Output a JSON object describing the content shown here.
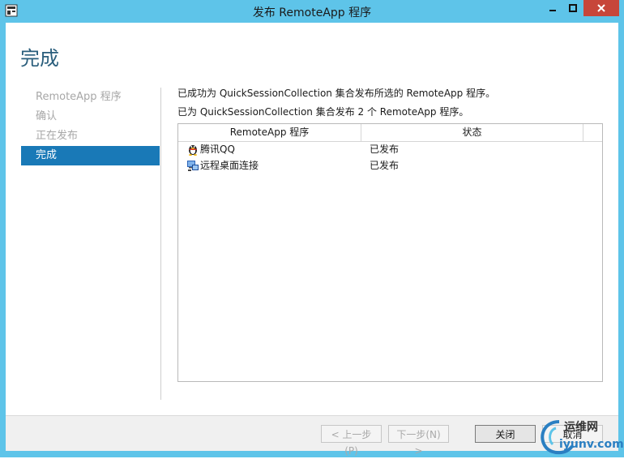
{
  "window": {
    "title": "发布 RemoteApp 程序",
    "controls": {
      "minimize": "minimize-icon",
      "maximize": "maximize-icon",
      "close": "close-icon"
    }
  },
  "page": {
    "title": "完成"
  },
  "nav": {
    "items": [
      {
        "label": "RemoteApp 程序",
        "state": "disabled"
      },
      {
        "label": "确认",
        "state": "disabled"
      },
      {
        "label": "正在发布",
        "state": "disabled"
      },
      {
        "label": "完成",
        "state": "active"
      }
    ]
  },
  "messages": {
    "line1": "已成功为 QuickSessionCollection 集合发布所选的 RemoteApp 程序。",
    "line2": "已为 QuickSessionCollection 集合发布 2 个 RemoteApp 程序。"
  },
  "table": {
    "headers": [
      "RemoteApp 程序",
      "状态"
    ],
    "rows": [
      {
        "name": "腾讯QQ",
        "status": "已发布",
        "icon": "qq-penguin-icon"
      },
      {
        "name": "远程桌面连接",
        "status": "已发布",
        "icon": "remote-desktop-icon"
      }
    ]
  },
  "buttons": {
    "prev": "< 上一步(P)",
    "next": "下一步(N) >",
    "close": "关闭",
    "cancel": "取消"
  },
  "watermark": {
    "top": "运维网",
    "bottom": "iyunv.com"
  },
  "colors": {
    "frame": "#5ec4e9",
    "accent": "#1979b7",
    "title": "#2a5e7c",
    "close_button": "#c7463a"
  }
}
